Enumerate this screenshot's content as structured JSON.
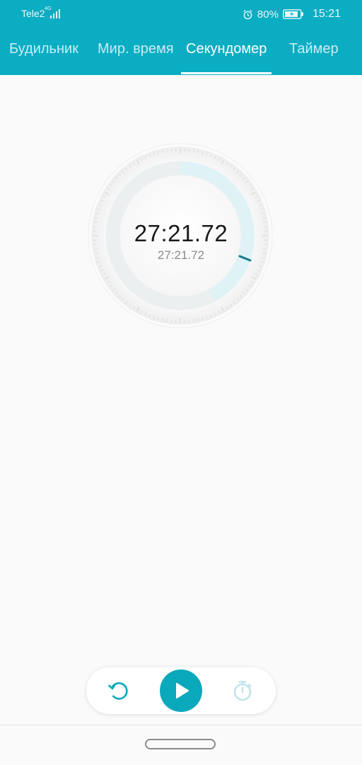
{
  "status_bar": {
    "carrier": "Tele2",
    "network_badge": "4G",
    "battery_percent": "80%",
    "time": "15:21",
    "icons": [
      "signal-icon",
      "alarm-icon",
      "battery-charging-icon"
    ]
  },
  "tabs": [
    {
      "label": "Будильник",
      "active": false
    },
    {
      "label": "Мир. время",
      "active": false
    },
    {
      "label": "Секундомер",
      "active": true
    },
    {
      "label": "Таймер",
      "active": false
    }
  ],
  "stopwatch": {
    "elapsed": "27:21.72",
    "current_lap": "27:21.72"
  },
  "controls": {
    "reset_icon": "reset-icon",
    "play_icon": "play-icon",
    "lap_icon": "stopwatch-icon"
  },
  "colors": {
    "accent": "#0aadc2",
    "play_button": "#0aa8bb",
    "progress_arc": "#dff3f7",
    "second_hand": "#127a8a",
    "disabled_icon": "#bfe3ea"
  }
}
